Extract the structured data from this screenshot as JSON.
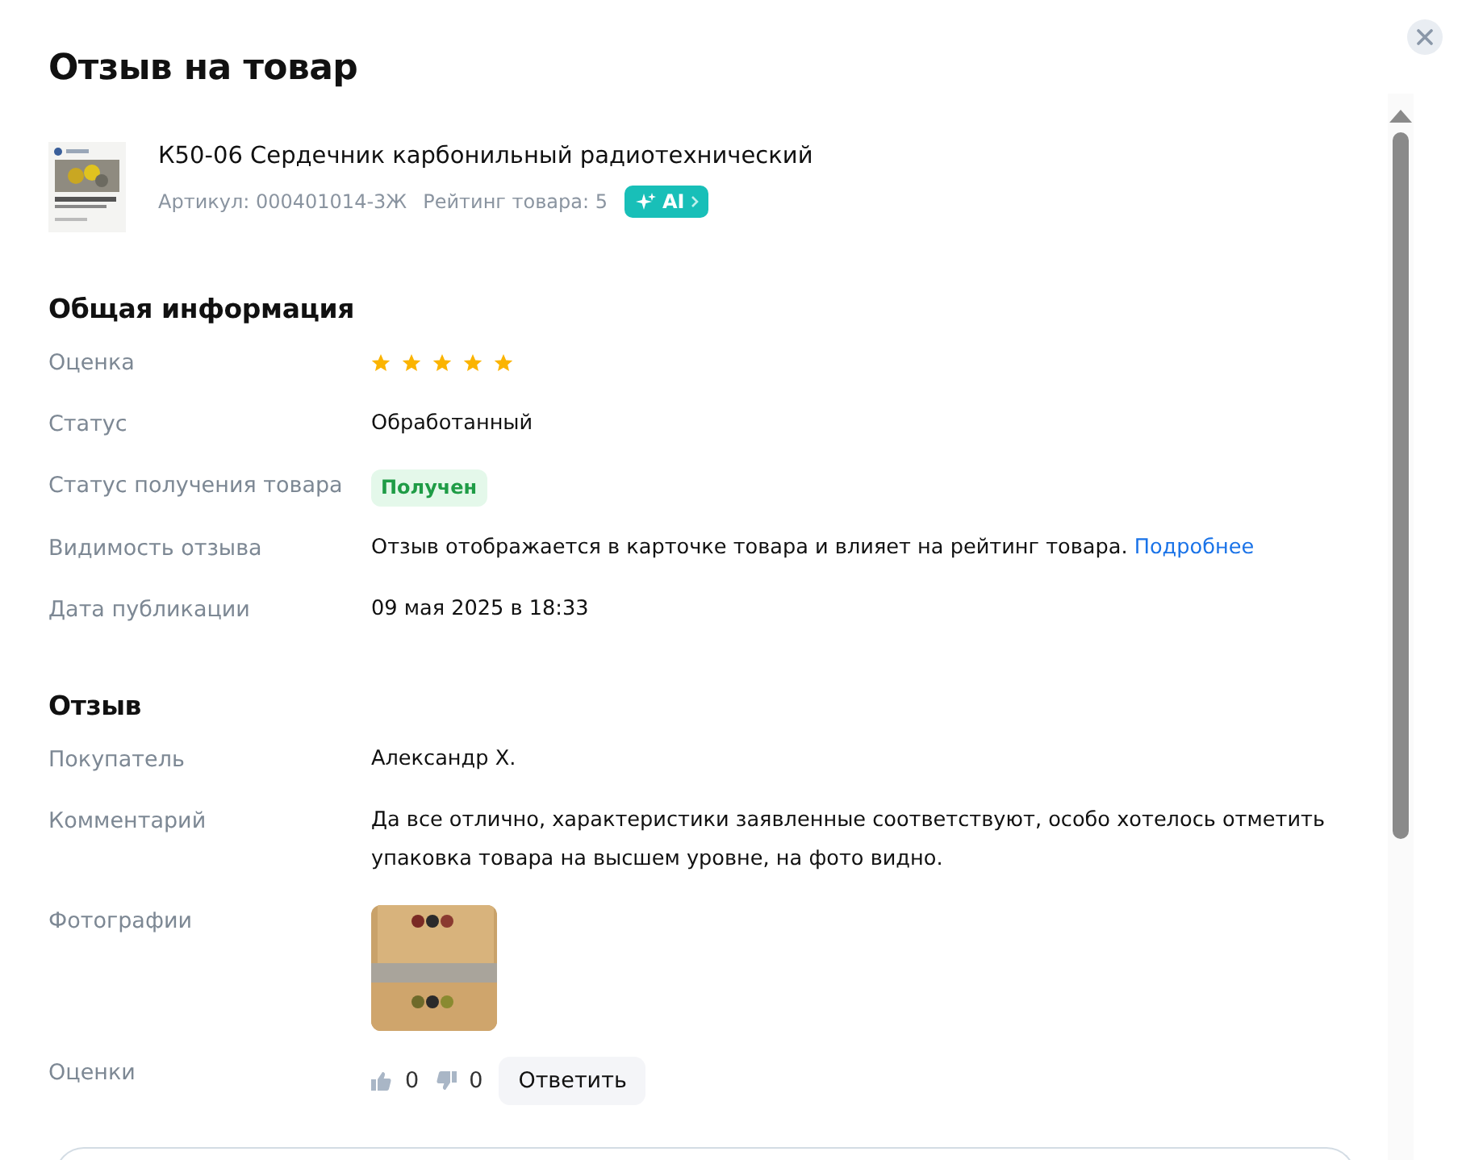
{
  "dialog": {
    "title": "Отзыв на товар"
  },
  "product": {
    "name": "К50-06 Сердечник карбонильный радиотехнический",
    "article": "Артикул: 000401014-3Ж",
    "rating": "Рейтинг товара: 5",
    "ai_badge": "AI"
  },
  "general": {
    "heading": "Общая информация",
    "rows": [
      {
        "kind": "stars",
        "label": "Оценка",
        "stars": 5
      },
      {
        "kind": "text",
        "label": "Статус",
        "value": "Обработанный"
      },
      {
        "kind": "badge",
        "label": "Статус получения товара",
        "value": "Получен"
      },
      {
        "kind": "text",
        "label": "Видимость отзыва",
        "value": "Отзыв отображается в карточке товара и влияет на рейтинг товара.",
        "link": "Подробнее"
      },
      {
        "kind": "text",
        "label": "Дата публикации",
        "value": "09 мая 2025 в 18:33"
      }
    ]
  },
  "review": {
    "heading": "Отзыв",
    "rows": [
      {
        "kind": "text",
        "label": "Покупатель",
        "value": "Александр Х."
      },
      {
        "kind": "text",
        "label": "Комментарий",
        "value": "Да все отлично, характеристики заявленные соответствуют, особо хотелось отметить упаковка товара на высшем уровне, на фото видно."
      },
      {
        "kind": "photos",
        "label": "Фотографии"
      },
      {
        "kind": "votes",
        "label": "Оценки",
        "likes": "0",
        "dislikes": "0",
        "reply_button": "Ответить"
      }
    ]
  }
}
